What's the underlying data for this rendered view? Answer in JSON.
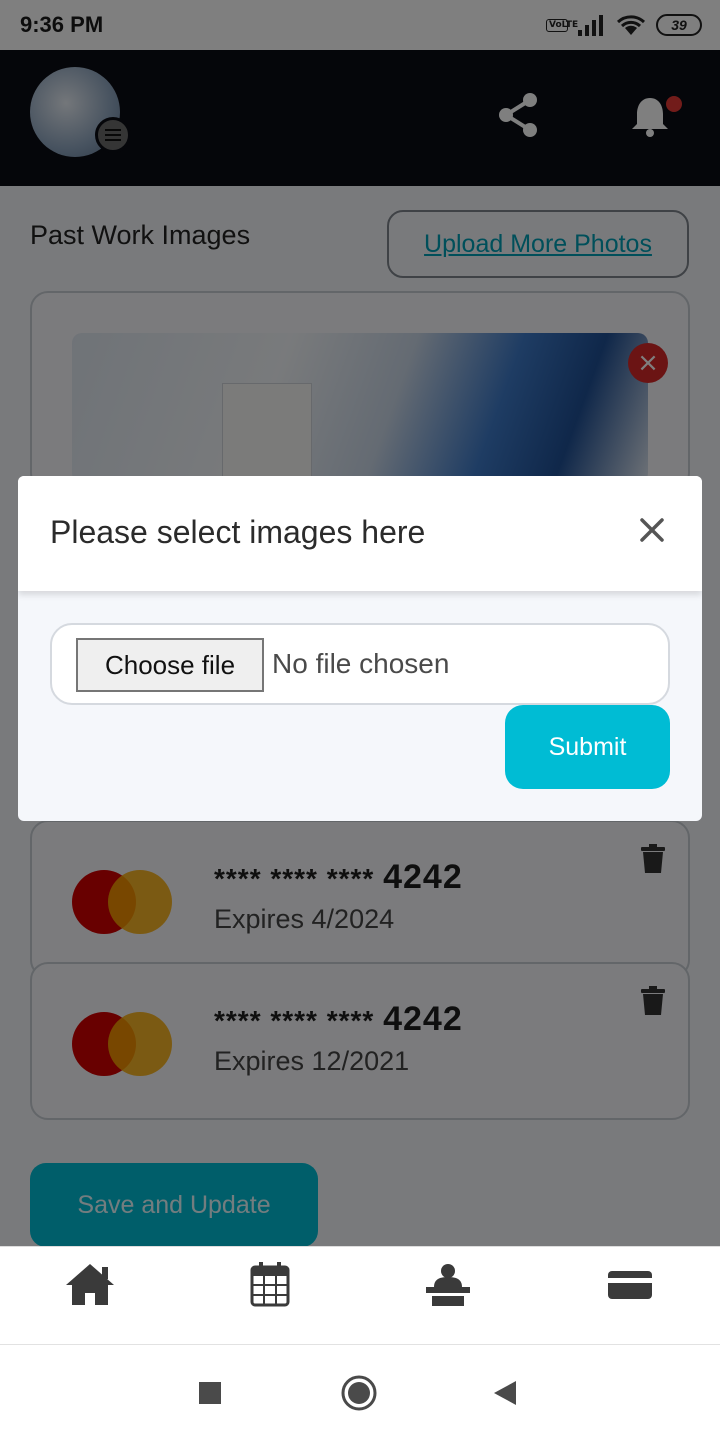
{
  "status_bar": {
    "time": "9:36 PM",
    "network": "VoLTE",
    "battery": "39"
  },
  "header": {
    "avatar": "profile-photo",
    "share_icon": "share-icon",
    "notification_icon": "bell-icon",
    "notification_dot_color": "#e53935"
  },
  "main": {
    "section_title": "Past Work Images",
    "upload_button": "Upload More Photos",
    "image_remove_icon": "close-icon",
    "cards": [
      {
        "masked": "**** **** ****",
        "last4": "4242",
        "expiry": "Expires 4/2024",
        "brand": "mastercard"
      },
      {
        "masked": "**** **** ****",
        "last4": "4242",
        "expiry": "Expires 12/2021",
        "brand": "mastercard"
      }
    ],
    "save_button": "Save and Update"
  },
  "modal": {
    "title": "Please select images here",
    "choose_file": "Choose file",
    "no_file": "No file chosen",
    "submit": "Submit"
  },
  "bottom_nav": {
    "items": [
      "home-icon",
      "calendar-icon",
      "staff-icon",
      "payment-card-icon"
    ]
  },
  "system_nav": {
    "items": [
      "recents",
      "home",
      "back"
    ]
  },
  "colors": {
    "accent": "#00bcd4",
    "link": "#009fb5",
    "header_bg": "#0b0c14",
    "delete": "#d62828"
  }
}
